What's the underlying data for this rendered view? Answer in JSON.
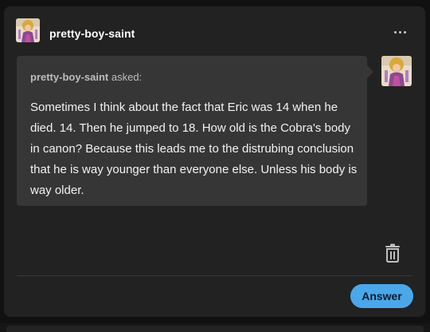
{
  "post": {
    "author": "pretty-boy-saint",
    "author_avatar_icon": "user-avatar-icon",
    "more_icon": "more-options-icon"
  },
  "ask": {
    "asker_name": "pretty-boy-saint",
    "asked_label": "asked:",
    "question": "Sometimes I think about the fact that Eric was 14 when he died. 14. Then he jumped to 18. How old is the Cobra's body in canon? Because this leads me to the distrubing conclusion that he is way younger than everyone else. Unless his body is way older.",
    "asker_avatar_icon": "user-avatar-icon"
  },
  "actions": {
    "delete_icon": "trash-icon",
    "answer_label": "Answer"
  },
  "colors": {
    "background": "#111111",
    "card": "#222222",
    "bubble": "#363636",
    "accent": "#4aa7ea",
    "text": "#f2f2f2",
    "muted": "#bdbdbd"
  }
}
